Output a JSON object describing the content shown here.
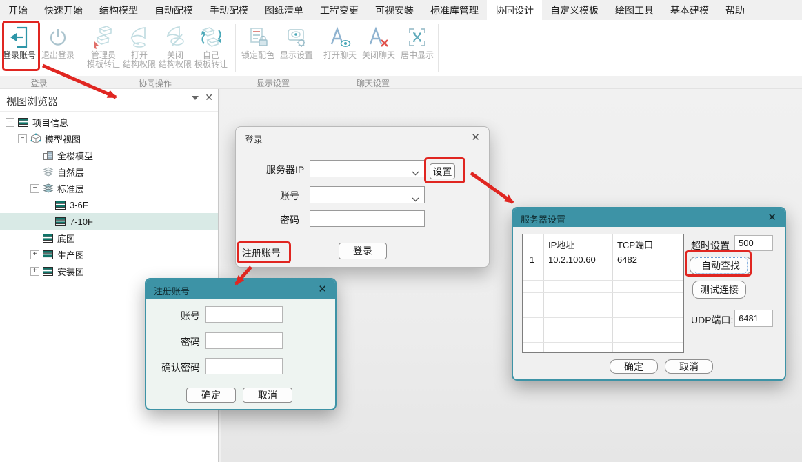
{
  "tabs": [
    "开始",
    "快速开始",
    "结构模型",
    "自动配模",
    "手动配模",
    "图纸清单",
    "工程变更",
    "可视安装",
    "标准库管理",
    "协同设计",
    "自定义模板",
    "绘图工具",
    "基本建模",
    "帮助"
  ],
  "active_tab": "协同设计",
  "ribbon": {
    "login_group_label": "登录",
    "collab_group_label": "协同操作",
    "display_group_label": "显示设置",
    "chat_group_label": "聊天设置",
    "buttons": {
      "login": "登录账号",
      "logout": "退出登录",
      "admin_line1": "管理员",
      "admin_line2": "模板转让",
      "open_perm_line1": "打开",
      "open_perm_line2": "结构权限",
      "close_perm_line1": "关闭",
      "close_perm_line2": "结构权限",
      "self_line1": "自己",
      "self_line2": "模板转让",
      "lock_color": "锁定配色",
      "display_settings": "显示设置",
      "open_chat": "打开聊天",
      "close_chat": "关闭聊天",
      "center_display": "居中显示"
    }
  },
  "sidebar": {
    "title": "视图浏览器",
    "tree": [
      {
        "label": "项目信息"
      },
      {
        "label": "模型视图"
      },
      {
        "label": "全楼模型"
      },
      {
        "label": "自然层"
      },
      {
        "label": "标准层"
      },
      {
        "label": "3-6F"
      },
      {
        "label": "7-10F"
      },
      {
        "label": "底图"
      },
      {
        "label": "生产图"
      },
      {
        "label": "安装图"
      }
    ],
    "selected_item": "7-10F"
  },
  "login_dialog": {
    "title": "登录",
    "server_ip_label": "服务器IP",
    "account_label": "账号",
    "password_label": "密码",
    "settings_button": "设置",
    "register_link": "注册账号",
    "login_button": "登录"
  },
  "register_dialog": {
    "title": "注册账号",
    "account_label": "账号",
    "password_label": "密码",
    "confirm_label": "确认密码",
    "ok_button": "确定",
    "cancel_button": "取消"
  },
  "server_dialog": {
    "title": "服务器设置",
    "col_ip": "IP地址",
    "col_tcp": "TCP端口",
    "row_num": "1",
    "row_ip": "10.2.100.60",
    "row_tcp": "6482",
    "timeout_label": "超时设置",
    "timeout_value": "500",
    "auto_find_button": "自动查找",
    "test_button": "测试连接",
    "udp_label": "UDP端口:",
    "udp_value": "6481",
    "ok_button": "确定",
    "cancel_button": "取消"
  },
  "colors": {
    "accent_teal": "#3D93A6",
    "annotation_red": "#E02621",
    "tree_selection": "#D9EAE6"
  }
}
